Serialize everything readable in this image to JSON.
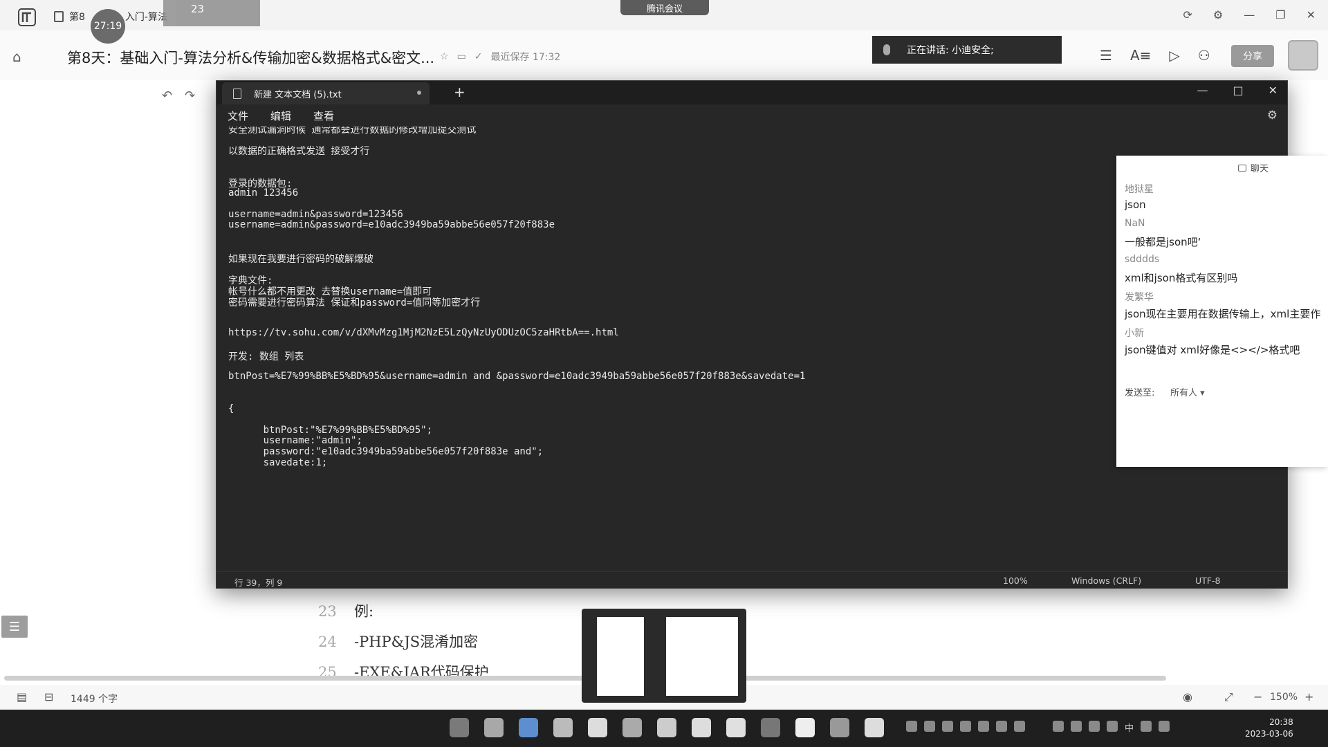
{
  "app": {
    "doc_tab_label": "第8",
    "doc_tab_label2": "入门-算法",
    "timer": "27:19",
    "notif_count": "23",
    "meeting_label": "腾讯会议",
    "doc_title": "第8天：基础入门-算法分析&传输加密&数据格式&密文...",
    "saved_status": "最近保存 17:32",
    "speaking": "正在讲话: 小迪安全;",
    "share_label": "分享"
  },
  "notepad": {
    "tab_title": "新建 文本文档 (5).txt",
    "menu": [
      "文件",
      "编辑",
      "查看"
    ],
    "lines": [
      "安全测试漏洞时候 通常都会进行数据的修改增加提交测试",
      "",
      "以数据的正确格式发送 接受才行",
      "",
      "",
      "登录的数据包:",
      "admin 123456",
      "",
      "username=admin&password=123456",
      "username=admin&password=e10adc3949ba59abbe56e057f20f883e",
      "",
      "",
      "如果现在我要进行密码的破解爆破",
      "",
      "字典文件:",
      "帐号什么都不用更改 去替换username=值即可",
      "密码需要进行密码算法 保证和password=值同等加密才行",
      "",
      "",
      "https://tv.sohu.com/v/dXMvMzg1MjM2NzE5LzQyNzUyODUzOC5zaHRtbA==.html",
      "",
      "开发: 数组 列表",
      "",
      "btnPost=%E7%99%BB%E5%BD%95&username=admin and &password=e10adc3949ba59abbe56e057f20f883e&savedate=1",
      "",
      "",
      "{",
      "",
      "      btnPost:\"%E7%99%BB%E5%BD%95\";",
      "      username:\"admin\";",
      "      password:\"e10adc3949ba59abbe56e057f20f883e and\";",
      "      savedate:1;"
    ],
    "status": {
      "position": "行 39，列 9",
      "zoom": "100%",
      "line_ending": "Windows (CRLF)",
      "encoding": "UTF-8"
    }
  },
  "chat": {
    "title": "聊天",
    "messages": [
      {
        "text": "地狱星",
        "kind": "name"
      },
      {
        "text": "json",
        "kind": "msg"
      },
      {
        "text": "NaN",
        "kind": "name"
      },
      {
        "text": "一般都是json吧‘",
        "kind": "msg"
      },
      {
        "text": "sdddds",
        "kind": "name"
      },
      {
        "text": "xml和json格式有区别吗",
        "kind": "msg"
      },
      {
        "text": "发繁华",
        "kind": "name"
      },
      {
        "text": "json现在主要用在数据传输上，xml主要作",
        "kind": "msg"
      },
      {
        "text": "小新",
        "kind": "name"
      },
      {
        "text": "json键值对  xml好像是<></>格式吧",
        "kind": "msg"
      }
    ],
    "send_to_label": "发送至:",
    "recipient": "所有人"
  },
  "doc_page": {
    "lines": [
      {
        "num": "23",
        "text": "例:"
      },
      {
        "num": "24",
        "text": "-PHP&JS混淆加密"
      },
      {
        "num": "25",
        "text": "-EXE&JAR代码保护"
      }
    ],
    "word_count": "1449 个字",
    "zoom": "150%"
  },
  "taskbar": {
    "time": "20:38",
    "date": "2023-03-06",
    "ime": "中",
    "icon_colors": [
      "#7a7a7a",
      "#a8a8a8",
      "#5d8fd0",
      "#bbbbbb",
      "#dddddd",
      "#aaaaaa",
      "#cccccc",
      "#dddddd",
      "#e0e0e0",
      "#777777",
      "#eeeeee",
      "#999999",
      "#dddddd"
    ]
  }
}
